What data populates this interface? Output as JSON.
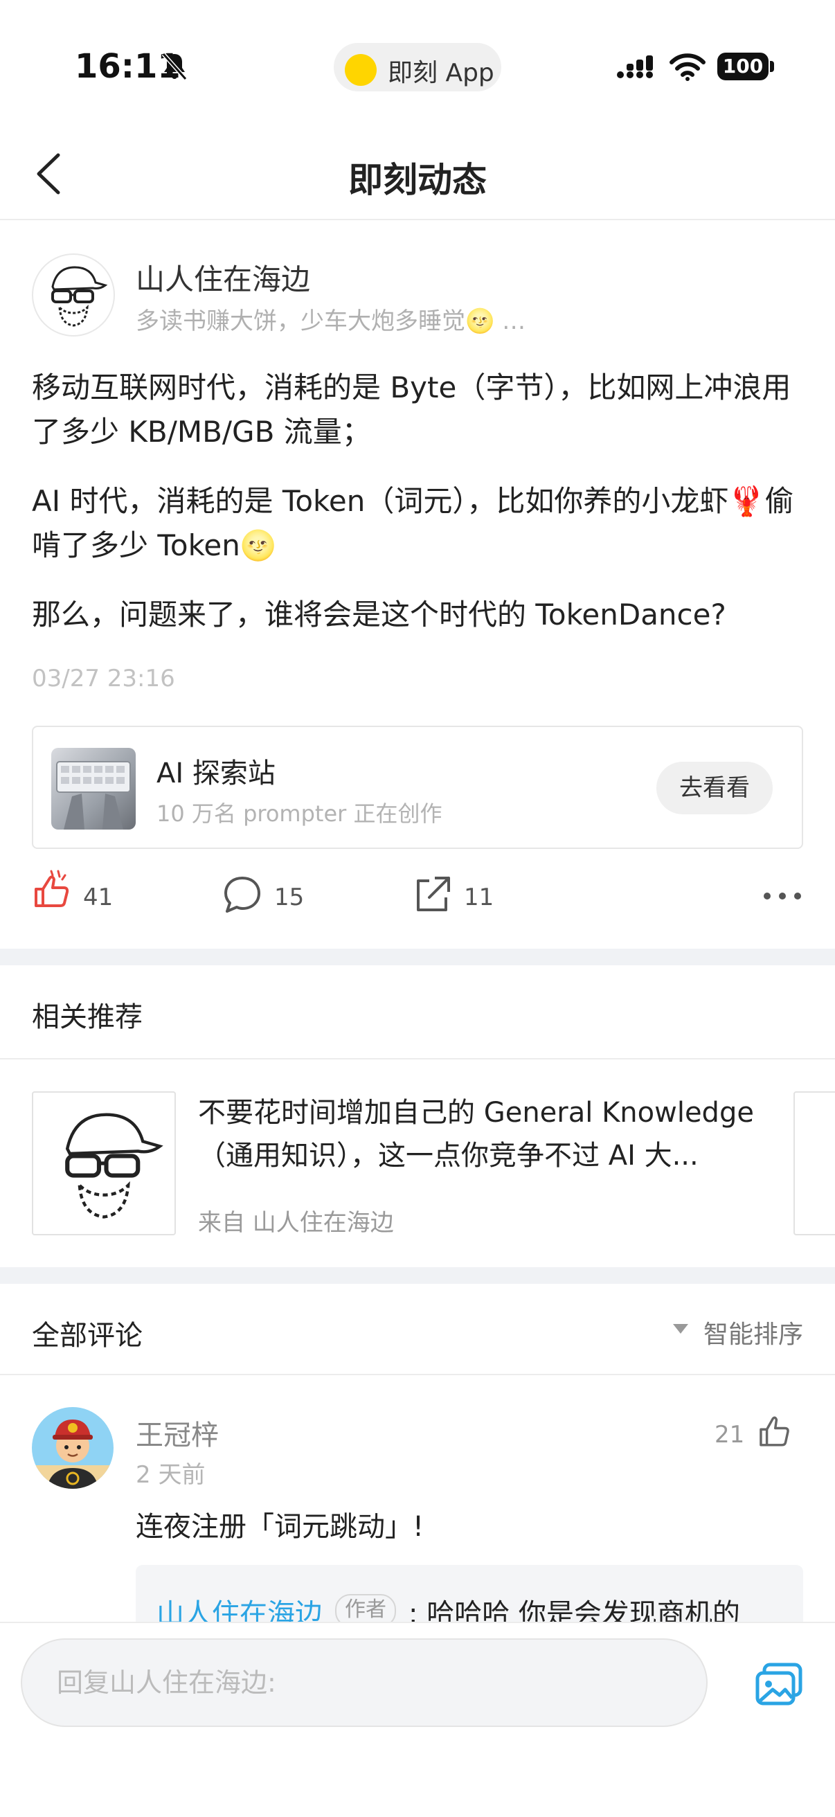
{
  "status_bar": {
    "time": "16:11",
    "app_pill": "即刻 App",
    "battery": "100"
  },
  "nav": {
    "title": "即刻动态"
  },
  "post": {
    "author": "山人住在海边",
    "bio": "多读书赚大饼，少车大炮多睡觉🌝 …",
    "paragraphs": [
      "移动互联网时代，消耗的是 Byte（字节），比如网上冲浪用了多少 KB/MB/GB 流量；",
      "AI 时代，消耗的是 Token（词元），比如你养的小龙虾🦞偷啃了多少 Token🌝",
      "那么，问题来了，谁将会是这个时代的 TokenDance?"
    ],
    "timestamp": "03/27 23:16",
    "topic": {
      "name": "AI 探索站",
      "subtitle": "10 万名 prompter 正在创作",
      "button": "去看看"
    },
    "actions": {
      "likes": "41",
      "comments": "15",
      "shares": "11"
    }
  },
  "related": {
    "section_title": "相关推荐",
    "item": {
      "title": "不要花时间增加自己的 General Knowledge（通用知识），这一点你竞争不过 AI 大...",
      "source": "来自 山人住在海边"
    }
  },
  "comments": {
    "section_title": "全部评论",
    "sort_label": "智能排序",
    "items": [
      {
        "name": "王冠梓",
        "time": "2 天前",
        "likes": "21",
        "text": "连夜注册「词元跳动」!",
        "reply": {
          "author": "山人住在海边",
          "tag": "作者",
          "text": ": 哈哈哈 你是会发现商机的"
        }
      }
    ]
  },
  "reply_bar": {
    "placeholder": "回复山人住在海边:"
  },
  "colors": {
    "accent_blue": "#2aa4e4",
    "like_red": "#e8483f",
    "app_yellow": "#ffd500"
  }
}
